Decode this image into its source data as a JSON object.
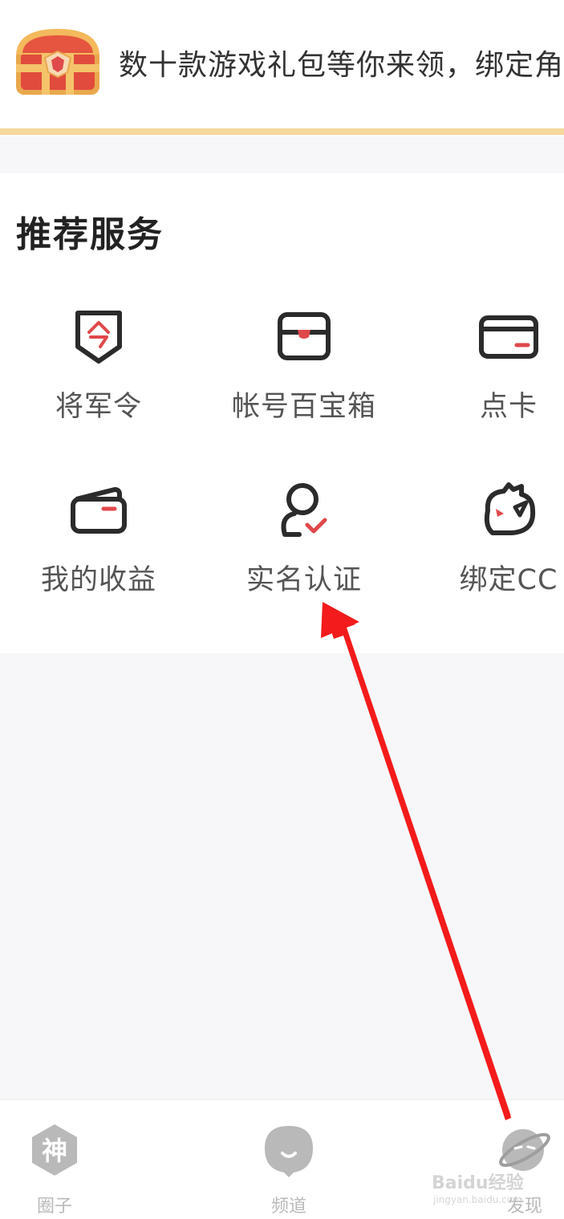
{
  "banner": {
    "text": "数十款游戏礼包等你来领，绑定角色"
  },
  "services": {
    "title": "推荐服务",
    "items": [
      {
        "label": "将军令",
        "icon": "shield-token-icon"
      },
      {
        "label": "帐号百宝箱",
        "icon": "account-box-icon"
      },
      {
        "label": "点卡",
        "icon": "card-icon"
      },
      {
        "label": "我的收益",
        "icon": "wallet-icon"
      },
      {
        "label": "实名认证",
        "icon": "user-verify-icon"
      },
      {
        "label": "绑定CC",
        "icon": "cc-bind-icon"
      }
    ]
  },
  "tabbar": {
    "tabs": [
      {
        "label": "圈子",
        "icon_text": "神",
        "icon": "circle-hexagon-icon"
      },
      {
        "label": "频道",
        "icon": "channel-bubble-icon"
      },
      {
        "label": "发现",
        "icon": "planet-icon"
      }
    ]
  },
  "watermark": {
    "text": "Baidu经验",
    "sub": "jingyan.baidu.com"
  },
  "colors": {
    "accent_red": "#e0484b",
    "banner_line": "#f5d89a",
    "icon_stroke": "#2b2b2b",
    "arrow": "#f31b1b"
  }
}
